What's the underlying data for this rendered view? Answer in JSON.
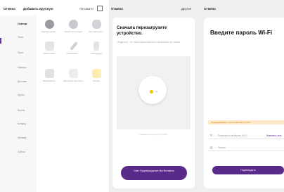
{
  "panel_list": {
    "header": {
      "cancel": "Отмена",
      "title": "Добавить вручную",
      "auto": "Автомати"
    },
    "categories": [
      {
        "label": "Освеще"
      },
      {
        "label": "Элек"
      },
      {
        "label": "Прис"
      },
      {
        "label": "Камеры"
      },
      {
        "label": "Датчики"
      },
      {
        "label": "Крупн"
      },
      {
        "label": "Бытов"
      },
      {
        "label": "Кондиц"
      },
      {
        "label": "Мелкий"
      },
      {
        "label": "Зубны"
      }
    ],
    "devices": [
      {
        "label": "Светоди-одная..."
      },
      {
        "label": "Умный потолочный"
      },
      {
        "label": "Светодио-дная..."
      },
      {
        "label": "Умная лампа"
      },
      {
        "label": "Светильник..."
      },
      {
        "label": "Светодиоды"
      },
      {
        "label": "Выключатель"
      },
      {
        "label": "Светодиод-ная лента"
      },
      {
        "label": "Ночник"
      }
    ]
  },
  "panel_reset": {
    "cancel": "Отмена",
    "other": "Другие",
    "heading": "Сначала перезагрузите устройство.",
    "subtext": "Убедитесь, что была подготовлена и загорелись ли лампы",
    "hint": "Нажмите кнопку на устройстве",
    "button": "Свет Подтверждение Вы Вставить"
  },
  "panel_wifi": {
    "cancel": "Отмена",
    "heading": "Введите пароль Wi-Fi",
    "note": "Поддерживается только сеть Wi-Fi 2,4ГГ",
    "wifi_label": "Пожалуйста выберите Wi-Fi",
    "change_link": "Изменить сеть",
    "password_label": "Пароль",
    "confirm": "Подтвердить"
  },
  "colors": {
    "brand_purple": "#5a2a8a",
    "warning_orange": "#e07b00",
    "led_yellow": "#f5c200"
  }
}
